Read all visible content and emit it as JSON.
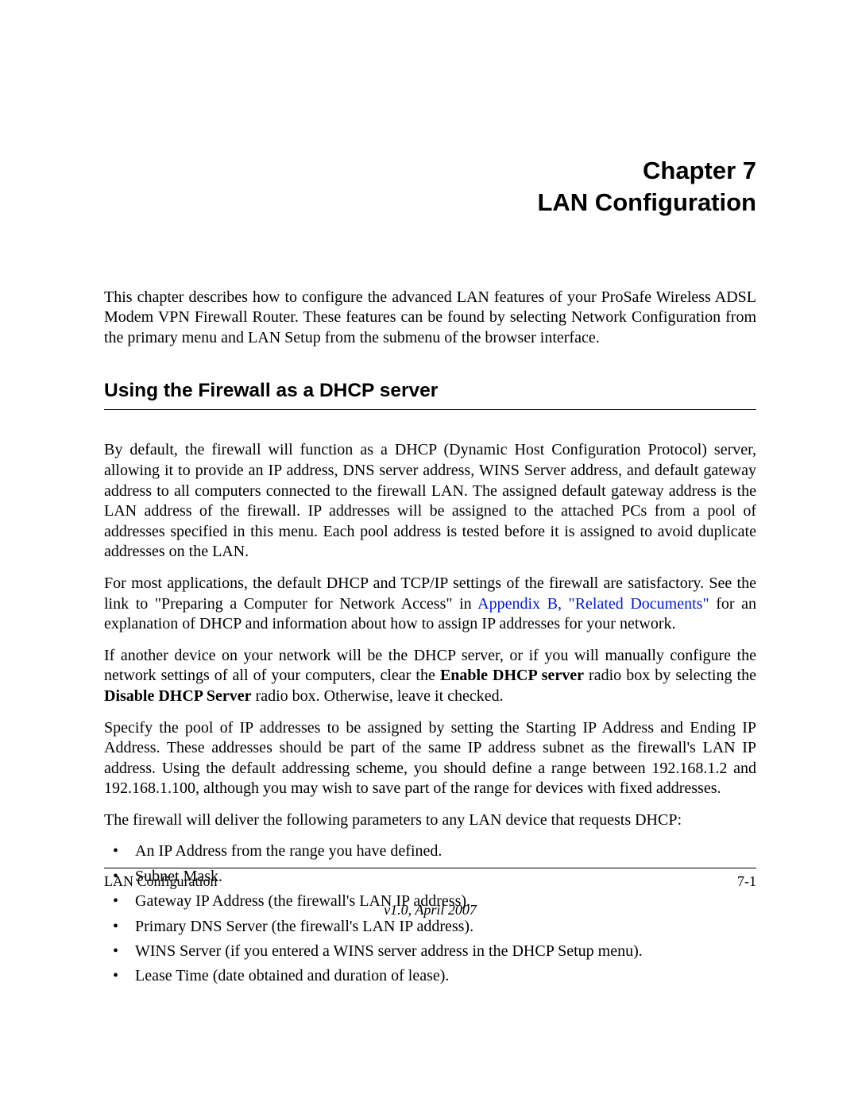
{
  "chapter": {
    "line1": "Chapter 7",
    "line2": "LAN Configuration"
  },
  "intro": "This chapter describes how to configure the advanced LAN features of your ProSafe Wireless ADSL Modem VPN Firewall Router. These features can be found by selecting Network Configuration from the primary menu and LAN Setup from the submenu of the browser interface.",
  "section": {
    "title": "Using the Firewall as a DHCP server"
  },
  "para1": "By default, the firewall will function as a DHCP (Dynamic Host Configuration Protocol) server, allowing it to provide an IP address, DNS server address, WINS Server address, and default gateway address to all computers connected to the firewall LAN. The assigned default gateway address is the LAN address of the firewall. IP addresses will be assigned to the attached PCs from a pool of addresses specified in this menu. Each pool address is tested before it is assigned to avoid duplicate addresses on the LAN.",
  "para2": {
    "pre": "For most applications, the default DHCP and TCP/IP settings of the firewall are satisfactory. See the link to \"Preparing a Computer for Network Access\" in ",
    "link": "Appendix B, \"Related Documents\"",
    "post": " for an explanation of DHCP and information about how to assign IP addresses for your network."
  },
  "para3": {
    "t1": "If another device on your network will be the DHCP server, or if you will manually configure the network settings of all of your computers, clear the ",
    "b1": "Enable DHCP server",
    "t2": " radio box by selecting the ",
    "b2": "Disable DHCP Server",
    "t3": " radio box. Otherwise, leave it checked."
  },
  "para4": "Specify the pool of IP addresses to be assigned by setting the Starting IP Address and Ending IP Address. These addresses should be part of the same IP address subnet as the firewall's LAN IP address. Using the default addressing scheme, you should define a range between 192.168.1.2 and 192.168.1.100, although you may wish to save part of the range for devices with fixed addresses.",
  "para5": "The firewall will deliver the following parameters to any LAN device that requests DHCP:",
  "bullets": [
    "An IP Address from the range you have defined.",
    "Subnet Mask.",
    "Gateway IP Address (the firewall's LAN IP address).",
    "Primary DNS Server (the firewall's LAN IP address).",
    "WINS Server (if you entered a WINS server address in the DHCP Setup menu).",
    "Lease Time (date obtained and duration of lease)."
  ],
  "footer": {
    "left": "LAN Configuration",
    "right": "7-1",
    "version": "v1.0, April 2007"
  }
}
